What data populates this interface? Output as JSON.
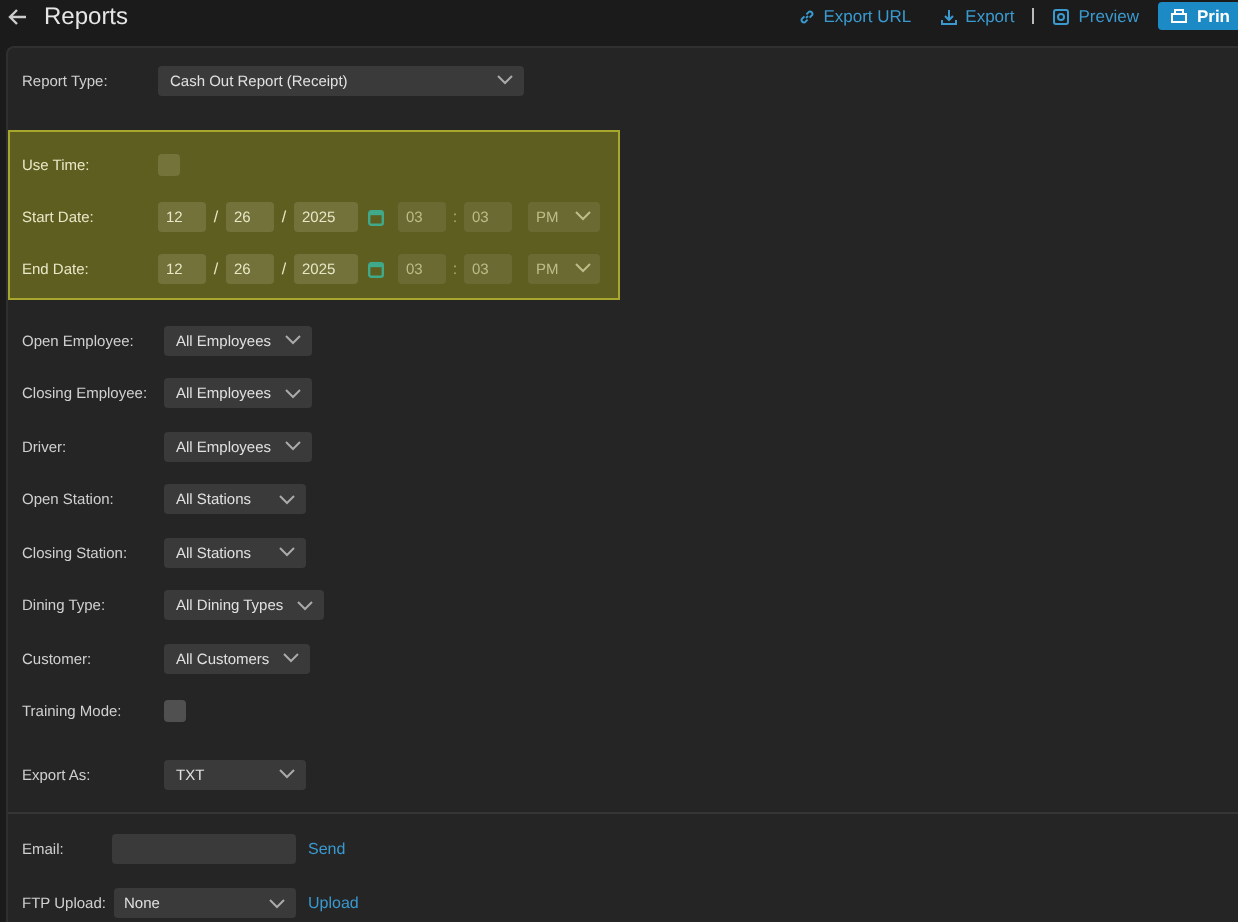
{
  "header": {
    "title": "Reports",
    "actions": [
      {
        "label": "Export URL",
        "kind": "link"
      },
      {
        "label": "Export",
        "kind": "download"
      },
      {
        "label": "Preview",
        "kind": "preview"
      }
    ],
    "print_button": "Prin"
  },
  "report_type": {
    "label": "Report Type:",
    "value": "Cash Out Report (Receipt)"
  },
  "time_group": {
    "highlighted": true,
    "use_time": {
      "label": "Use Time:",
      "checked": false
    },
    "dates": [
      {
        "label": "Start Date:",
        "month": "12",
        "date_separator_1": "/",
        "day": "26",
        "date_separator_2": "/",
        "year": "2025",
        "hour": "03",
        "time_separator": ":",
        "minute": "03",
        "ampm": "PM"
      },
      {
        "label": "End Date:",
        "month": "12",
        "date_separator_1": "/",
        "day": "26",
        "date_separator_2": "/",
        "year": "2025",
        "hour": "03",
        "time_separator": ":",
        "minute": "03",
        "ampm": "PM"
      }
    ]
  },
  "filters": [
    {
      "kind": "select",
      "label": "Open Employee:",
      "value": "All Employees"
    },
    {
      "kind": "select",
      "label": "Closing Employee:",
      "value": "All Employees"
    },
    {
      "kind": "select",
      "label": "Driver:",
      "value": "All Employees"
    },
    {
      "kind": "select",
      "label": "Open Station:",
      "value": "All Stations"
    },
    {
      "kind": "select",
      "label": "Closing Station:",
      "value": "All Stations"
    },
    {
      "kind": "select",
      "label": "Dining Type:",
      "value": "All Dining Types"
    },
    {
      "kind": "select",
      "label": "Customer:",
      "value": "All Customers"
    },
    {
      "kind": "checkbox",
      "label": "Training Mode:",
      "checked": false
    },
    {
      "kind": "select",
      "label": "Export As:",
      "value": "TXT"
    }
  ],
  "delivery": {
    "email": {
      "label": "Email:",
      "button": "Send"
    },
    "ftp": {
      "label": "FTP Upload:",
      "value": "None",
      "button": "Upload"
    }
  }
}
